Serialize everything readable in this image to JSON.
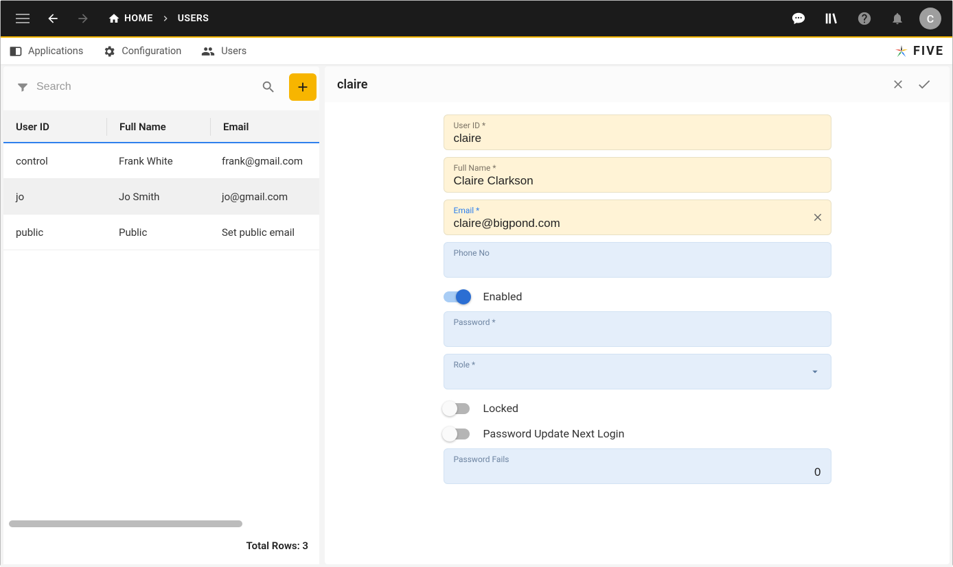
{
  "breadcrumb": {
    "home": "HOME",
    "current": "USERS"
  },
  "avatar_initial": "C",
  "tabs": {
    "applications": "Applications",
    "configuration": "Configuration",
    "users": "Users"
  },
  "brand": "FIVE",
  "search": {
    "placeholder": "Search"
  },
  "table": {
    "headers": {
      "user_id": "User ID",
      "full_name": "Full Name",
      "email": "Email"
    },
    "rows": [
      {
        "id": "control",
        "name": "Frank White",
        "email": "frank@gmail.com"
      },
      {
        "id": "jo",
        "name": "Jo Smith",
        "email": "jo@gmail.com"
      },
      {
        "id": "public",
        "name": "Public",
        "email": "Set public email"
      }
    ],
    "footer": "Total Rows: 3"
  },
  "form": {
    "title": "claire",
    "fields": {
      "user_id": {
        "label": "User ID *",
        "value": "claire"
      },
      "full_name": {
        "label": "Full Name *",
        "value": "Claire Clarkson"
      },
      "email": {
        "label": "Email *",
        "value": "claire@bigpond.com"
      },
      "phone": {
        "label": "Phone No",
        "value": ""
      },
      "enabled": {
        "label": "Enabled",
        "on": true
      },
      "password": {
        "label": "Password *",
        "value": ""
      },
      "role": {
        "label": "Role *",
        "value": ""
      },
      "locked": {
        "label": "Locked",
        "on": false
      },
      "password_update": {
        "label": "Password Update Next Login",
        "on": false
      },
      "password_fails": {
        "label": "Password Fails",
        "value": "0"
      }
    }
  }
}
